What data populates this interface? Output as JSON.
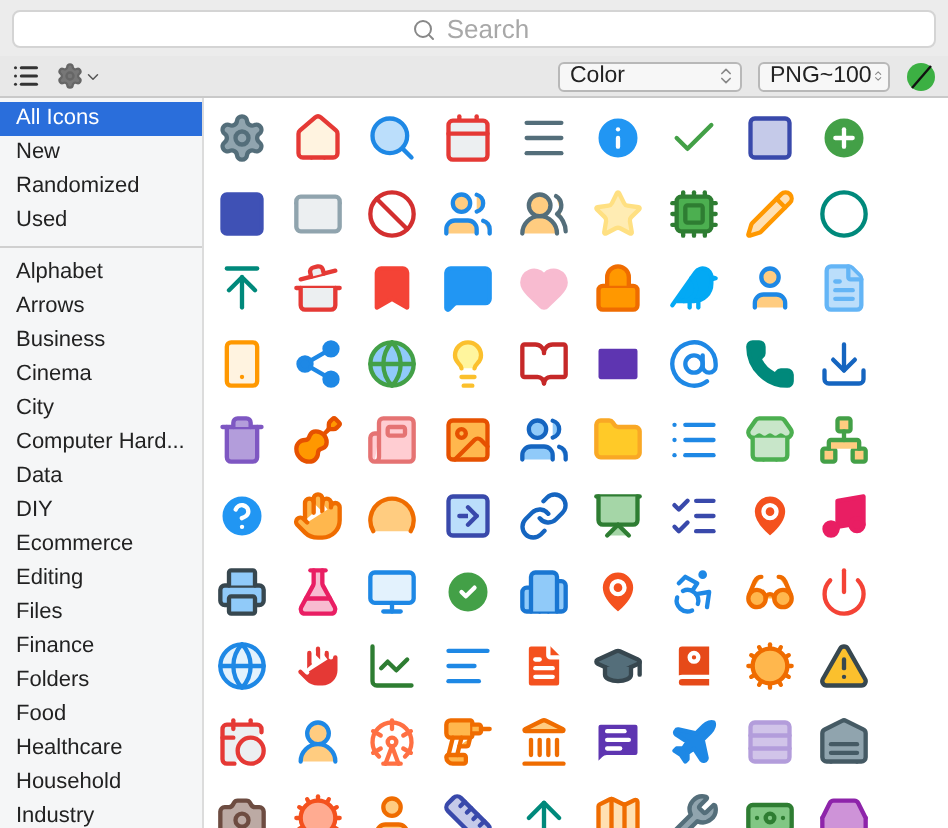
{
  "search": {
    "placeholder": "Search"
  },
  "toolbar": {
    "color_mode": "Color",
    "format": "PNG~100"
  },
  "sidebar": {
    "sections": [
      {
        "items": [
          {
            "label": "All Icons",
            "selected": true
          },
          {
            "label": "New",
            "selected": false
          },
          {
            "label": "Randomized",
            "selected": false
          },
          {
            "label": "Used",
            "selected": false
          }
        ]
      },
      {
        "items": [
          {
            "label": "Alphabet",
            "selected": false
          },
          {
            "label": "Arrows",
            "selected": false
          },
          {
            "label": "Business",
            "selected": false
          },
          {
            "label": "Cinema",
            "selected": false
          },
          {
            "label": "City",
            "selected": false
          },
          {
            "label": "Computer Hard...",
            "selected": false
          },
          {
            "label": "Data",
            "selected": false
          },
          {
            "label": "DIY",
            "selected": false
          },
          {
            "label": "Ecommerce",
            "selected": false
          },
          {
            "label": "Editing",
            "selected": false
          },
          {
            "label": "Files",
            "selected": false
          },
          {
            "label": "Finance",
            "selected": false
          },
          {
            "label": "Folders",
            "selected": false
          },
          {
            "label": "Food",
            "selected": false
          },
          {
            "label": "Healthcare",
            "selected": false
          },
          {
            "label": "Household",
            "selected": false
          },
          {
            "label": "Industry",
            "selected": false
          }
        ]
      }
    ]
  }
}
